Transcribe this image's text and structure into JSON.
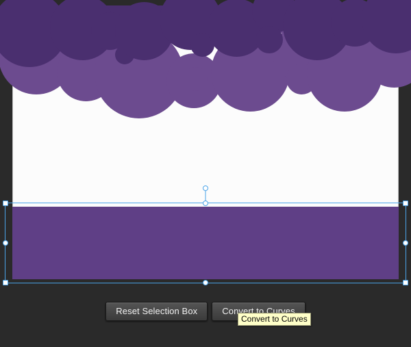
{
  "colors": {
    "cloud_front": "#4a2f6f",
    "cloud_back": "#6c4b8f",
    "ground": "#5f3f86",
    "selection": "#4aa3e8",
    "app_bg": "#2a2a2a"
  },
  "toolbar": {
    "reset_label": "Reset Selection Box",
    "convert_label": "Convert to Curves"
  },
  "tooltip": {
    "text": "Convert to Curves"
  }
}
